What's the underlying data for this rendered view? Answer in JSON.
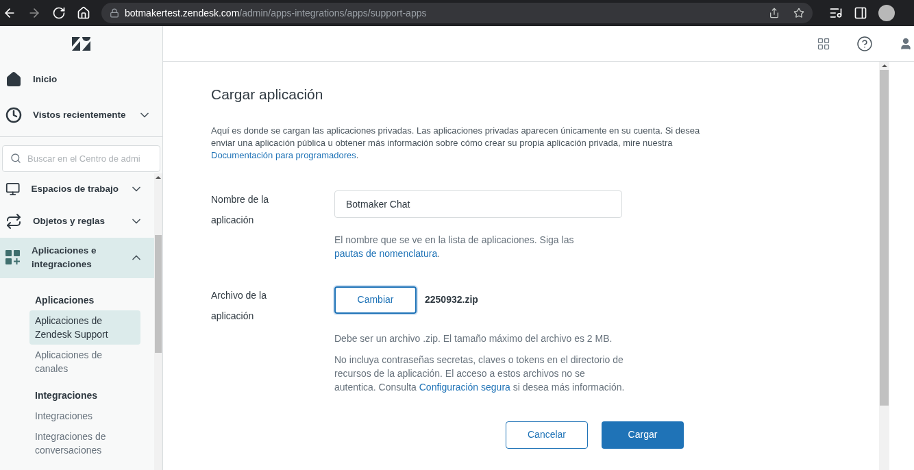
{
  "browser": {
    "url_host": "botmakertest.zendesk.com",
    "url_path": "/admin/apps-integrations/apps/support-apps"
  },
  "sidebar": {
    "top_items": [
      {
        "label": "Inicio"
      },
      {
        "label": "Vistos recientemente",
        "expanded": false
      }
    ],
    "search": {
      "placeholder": "Buscar en el Centro de admi"
    },
    "items": [
      {
        "label": "Espacios de trabajo",
        "expanded": false,
        "selected": false
      },
      {
        "label": "Objetos y reglas",
        "expanded": false,
        "selected": false
      },
      {
        "label": "Aplicaciones e integraciones",
        "expanded": true,
        "selected": true
      }
    ],
    "sections": [
      {
        "heading": "Aplicaciones",
        "items": [
          {
            "label": "Aplicaciones de Zendesk Support",
            "selected": true
          },
          {
            "label": "Aplicaciones de canales",
            "selected": false
          }
        ]
      },
      {
        "heading": "Integraciones",
        "items": [
          {
            "label": "Integraciones",
            "selected": false
          },
          {
            "label": "Integraciones de conversaciones",
            "selected": false
          }
        ]
      }
    ]
  },
  "page": {
    "title": "Cargar aplicación",
    "intro": {
      "text": "Aquí es donde se cargan las aplicaciones privadas. Las aplicaciones privadas aparecen únicamente en su cuenta. Si desea enviar una aplicación pública u obtener más información sobre cómo crear su propia aplicación privada, mire nuestra",
      "link": "Documentación para programadores",
      "after": "."
    },
    "name_field": {
      "label": "Nombre de la aplicación",
      "value": "Botmaker Chat",
      "hint": {
        "text": "El nombre que se ve en la lista de aplicaciones. Siga las",
        "link": "pautas de nomenclatura",
        "after": "."
      }
    },
    "file_field": {
      "label": "Archivo de la aplicación",
      "button": "Cambiar",
      "file_name": "2250932.zip",
      "hint": "Debe ser un archivo .zip. El tamaño máximo del archivo es 2 MB.",
      "warning": {
        "text": "No incluya contraseñas secretas, claves o tokens en el directorio de recursos de la aplicación. El acceso a estos archivos no se autentica. Consulta",
        "link": "Configuración segura",
        "after": "si desea más información."
      }
    },
    "buttons": [
      {
        "label": "Cancelar",
        "kind": "secondary"
      },
      {
        "label": "Cargar",
        "kind": "primary"
      }
    ]
  }
}
